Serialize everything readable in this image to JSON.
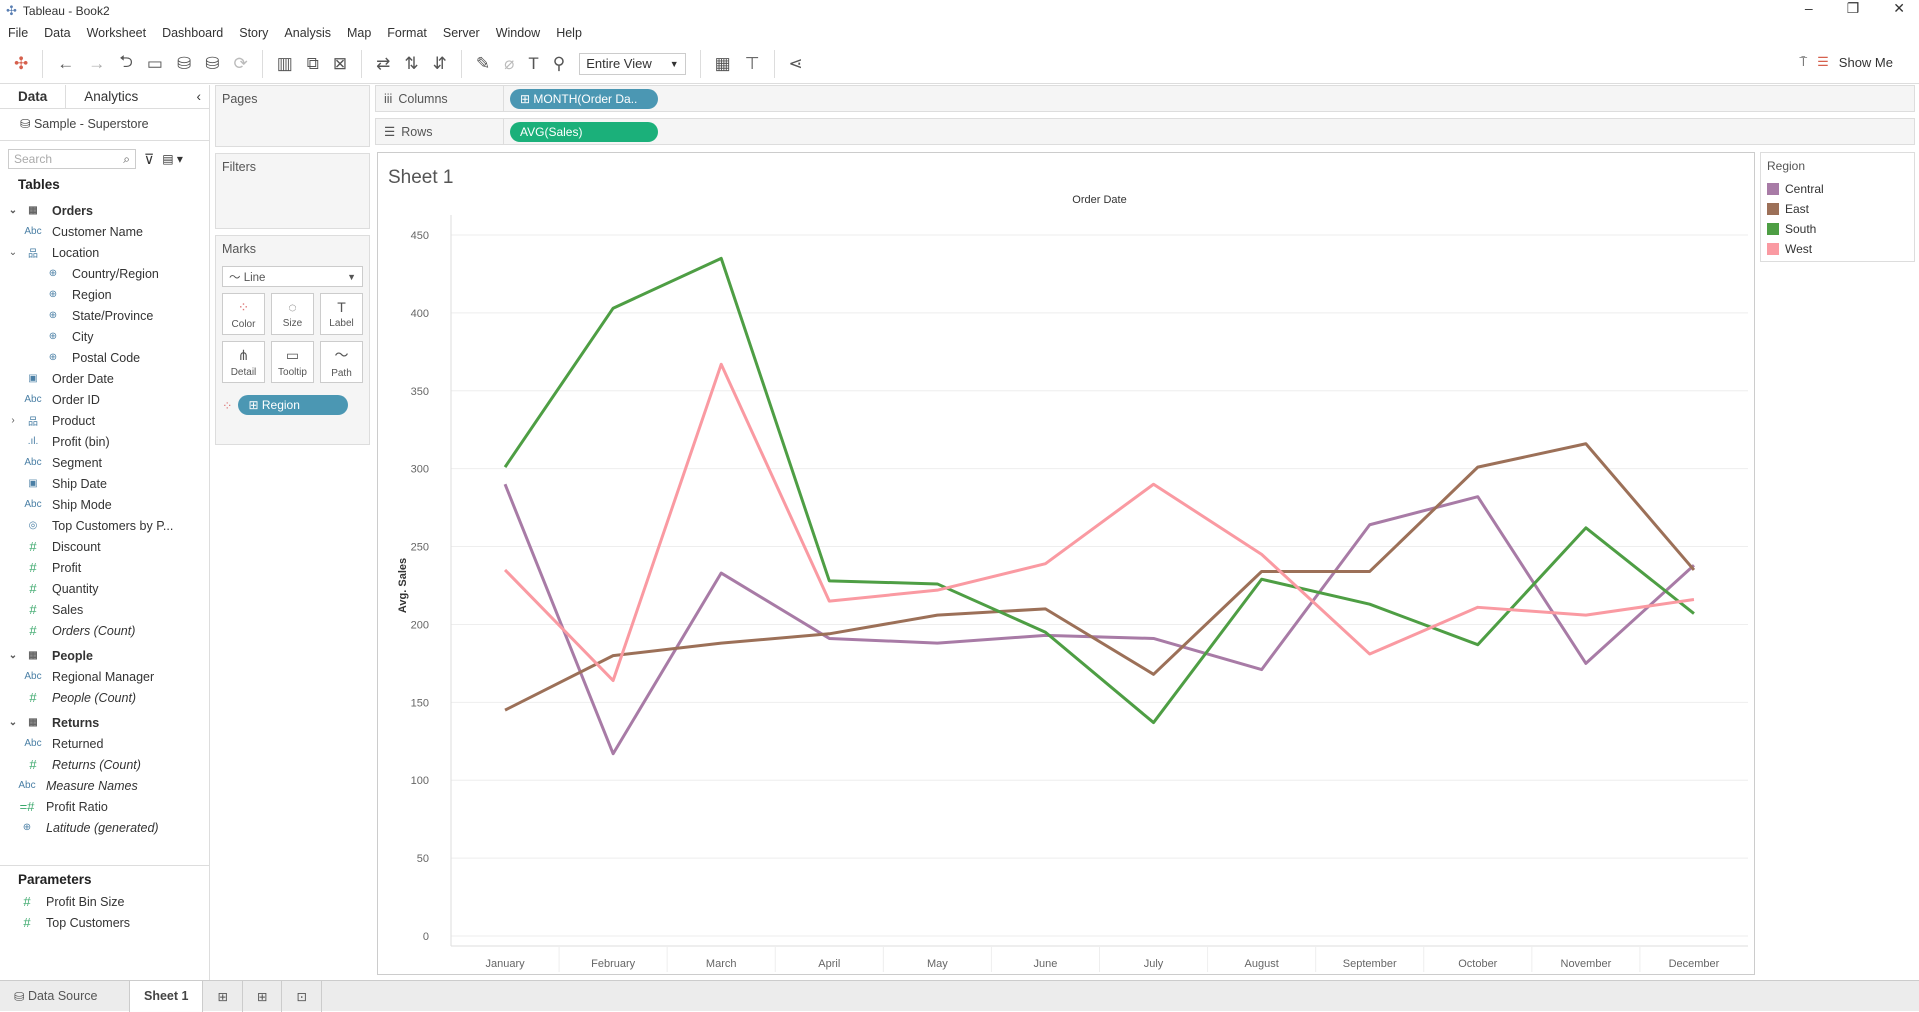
{
  "window": {
    "title": "Tableau - Book2"
  },
  "menu": [
    "File",
    "Data",
    "Worksheet",
    "Dashboard",
    "Story",
    "Analysis",
    "Map",
    "Format",
    "Server",
    "Window",
    "Help"
  ],
  "toolbar": {
    "fit": "Entire View",
    "show_me": "Show Me"
  },
  "sidebar": {
    "tabs": [
      "Data",
      "Analytics"
    ],
    "datasource": "Sample - Superstore",
    "search_placeholder": "Search",
    "tables_label": "Tables",
    "fields": [
      {
        "type": "table",
        "label": "Orders"
      },
      {
        "type": "abc",
        "label": "Customer Name"
      },
      {
        "type": "hier",
        "label": "Location",
        "arrow": "v"
      },
      {
        "type": "geo",
        "label": "Country/Region",
        "indent": true
      },
      {
        "type": "geo",
        "label": "Region",
        "indent": true
      },
      {
        "type": "geo",
        "label": "State/Province",
        "indent": true
      },
      {
        "type": "geo",
        "label": "City",
        "indent": true
      },
      {
        "type": "geo",
        "label": "Postal Code",
        "indent": true
      },
      {
        "type": "date",
        "label": "Order Date"
      },
      {
        "type": "abc",
        "label": "Order ID"
      },
      {
        "type": "hier",
        "label": "Product",
        "arrow": ">"
      },
      {
        "type": "bin",
        "label": "Profit (bin)"
      },
      {
        "type": "abc",
        "label": "Segment"
      },
      {
        "type": "date",
        "label": "Ship Date"
      },
      {
        "type": "abc",
        "label": "Ship Mode"
      },
      {
        "type": "set",
        "label": "Top Customers by P..."
      },
      {
        "type": "num",
        "label": "Discount"
      },
      {
        "type": "num",
        "label": "Profit"
      },
      {
        "type": "num",
        "label": "Quantity"
      },
      {
        "type": "num",
        "label": "Sales"
      },
      {
        "type": "num",
        "label": "Orders (Count)",
        "italic": true
      },
      {
        "type": "table",
        "label": "People"
      },
      {
        "type": "abc",
        "label": "Regional Manager"
      },
      {
        "type": "num",
        "label": "People (Count)",
        "italic": true
      },
      {
        "type": "table",
        "label": "Returns"
      },
      {
        "type": "abc",
        "label": "Returned"
      },
      {
        "type": "num",
        "label": "Returns (Count)",
        "italic": true
      },
      {
        "type": "abc",
        "label": "Measure Names",
        "italic": true,
        "top": true
      },
      {
        "type": "calc",
        "label": "Profit Ratio",
        "top": true
      },
      {
        "type": "geo",
        "label": "Latitude (generated)",
        "italic": true,
        "top": true
      }
    ],
    "parameters_label": "Parameters",
    "parameters": [
      "Profit Bin Size",
      "Top Customers"
    ]
  },
  "cards": {
    "pages": "Pages",
    "filters": "Filters",
    "marks": "Marks",
    "mark_type": "Line",
    "mark_buttons": [
      "Color",
      "Size",
      "Label",
      "Detail",
      "Tooltip",
      "Path"
    ],
    "color_pill": "Region"
  },
  "shelves": {
    "columns_label": "Columns",
    "columns_pill": "MONTH(Order Da..",
    "rows_label": "Rows",
    "rows_pill": "AVG(Sales)"
  },
  "sheet": {
    "title": "Sheet 1"
  },
  "legend": {
    "title": "Region",
    "items": [
      {
        "label": "Central",
        "color": "#a87ba6"
      },
      {
        "label": "East",
        "color": "#9c7058"
      },
      {
        "label": "South",
        "color": "#4e9e44"
      },
      {
        "label": "West",
        "color": "#fa9aa2"
      }
    ]
  },
  "bottom": {
    "data_source": "Data Source",
    "sheet_tab": "Sheet 1"
  },
  "chart_data": {
    "type": "line",
    "title": "Order Date",
    "xlabel": "Order Date",
    "ylabel": "Avg. Sales",
    "categories": [
      "January",
      "February",
      "March",
      "April",
      "May",
      "June",
      "July",
      "August",
      "September",
      "October",
      "November",
      "December"
    ],
    "yticks": [
      0,
      50,
      100,
      150,
      200,
      250,
      300,
      350,
      400,
      450
    ],
    "ylim": [
      0,
      450
    ],
    "grid": true,
    "legend": "right",
    "series": [
      {
        "name": "Central",
        "color": "#a87ba6",
        "values": [
          290,
          117,
          233,
          191,
          188,
          193,
          191,
          171,
          264,
          282,
          175,
          238
        ]
      },
      {
        "name": "East",
        "color": "#9c7058",
        "values": [
          145,
          180,
          188,
          194,
          206,
          210,
          168,
          234,
          234,
          301,
          316,
          235
        ]
      },
      {
        "name": "South",
        "color": "#4e9e44",
        "values": [
          301,
          403,
          435,
          228,
          226,
          195,
          137,
          229,
          213,
          187,
          262,
          207
        ]
      },
      {
        "name": "West",
        "color": "#fa9aa2",
        "values": [
          235,
          164,
          367,
          215,
          222,
          239,
          290,
          245,
          181,
          211,
          206,
          216
        ]
      }
    ]
  }
}
